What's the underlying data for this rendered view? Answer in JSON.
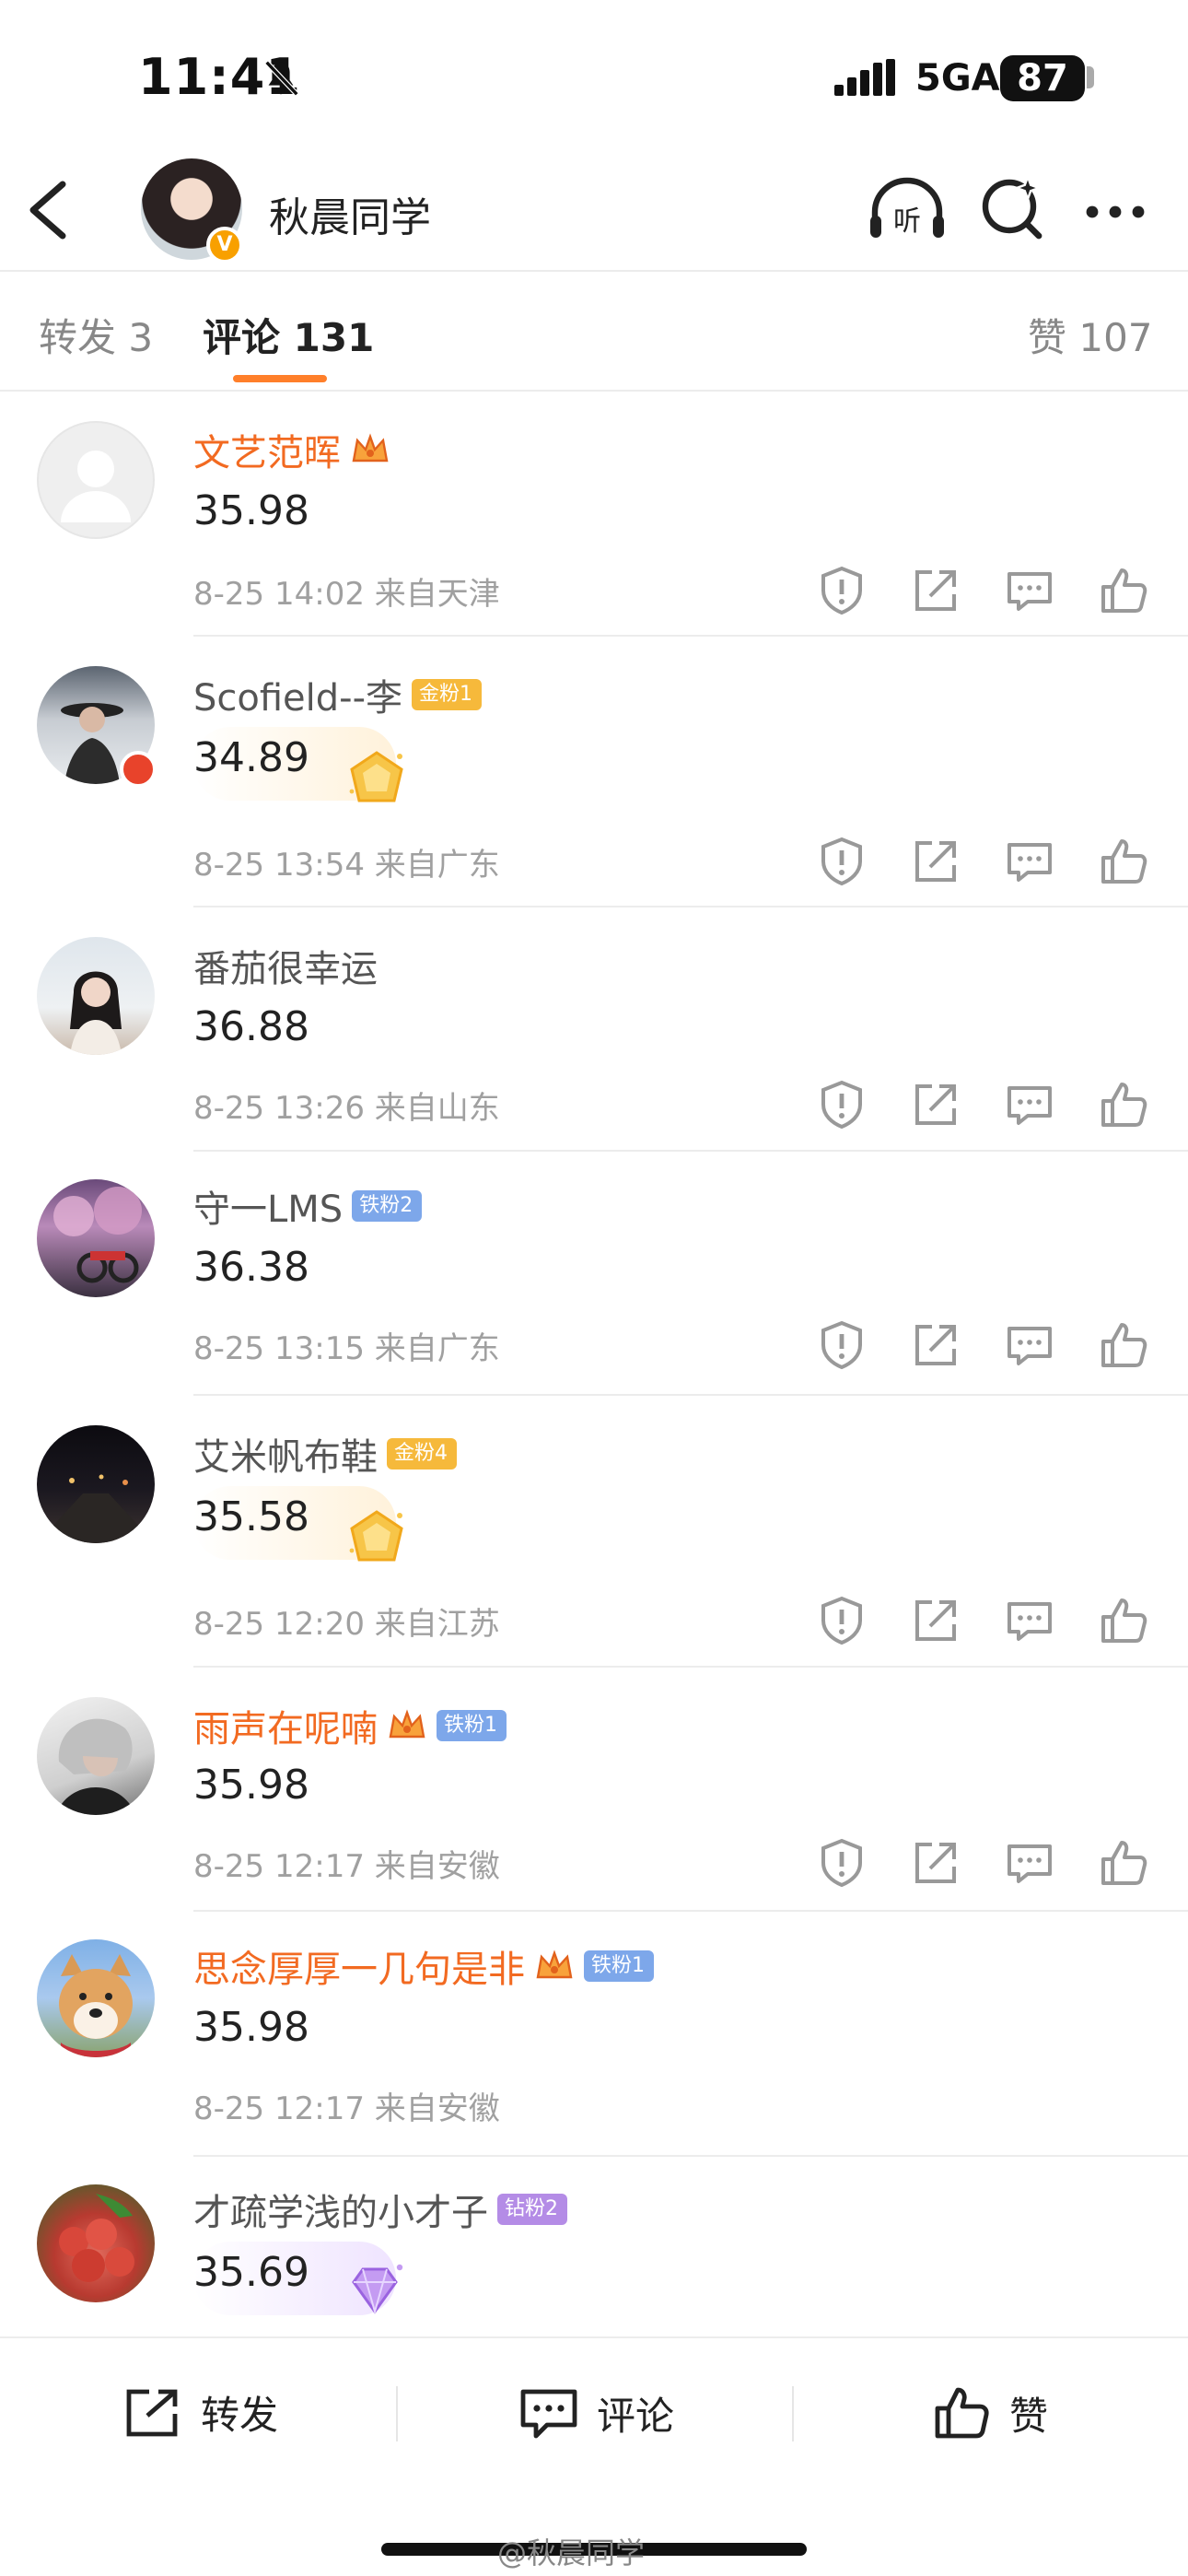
{
  "status": {
    "time": "11:41",
    "network": "5GA",
    "battery": "87"
  },
  "header": {
    "name": "秋晨同学",
    "listen_label": "听"
  },
  "tabs": {
    "repost": "转发 3",
    "comments": "评论 131",
    "likes": "赞 107"
  },
  "comments": [
    {
      "name": "文艺范晖",
      "vip": true,
      "crown": true,
      "badge": null,
      "text": "35.98",
      "meta": "8-25 14:02  来自天津",
      "medal": null
    },
    {
      "name": "Scofield--李",
      "vip": false,
      "crown": false,
      "badge": {
        "label": "金粉1",
        "type": "gold"
      },
      "text": "34.89",
      "meta": "8-25 13:54  来自广东",
      "medal": "gold"
    },
    {
      "name": "番茄很幸运",
      "vip": false,
      "crown": false,
      "badge": null,
      "text": "36.88",
      "meta": "8-25 13:26  来自山东",
      "medal": null
    },
    {
      "name": "守一LMS",
      "vip": false,
      "crown": false,
      "badge": {
        "label": "铁粉2",
        "type": "iron"
      },
      "text": "36.38",
      "meta": "8-25 13:15  来自广东",
      "medal": null
    },
    {
      "name": "艾米帆布鞋",
      "vip": false,
      "crown": false,
      "badge": {
        "label": "金粉4",
        "type": "gold"
      },
      "text": "35.58",
      "meta": "8-25 12:20  来自江苏",
      "medal": "gold"
    },
    {
      "name": "雨声在呢喃",
      "vip": true,
      "crown": true,
      "badge": {
        "label": "铁粉1",
        "type": "iron"
      },
      "text": "35.98",
      "meta": "8-25 12:17  来自安徽",
      "medal": null
    },
    {
      "name": "思念厚厚一几句是非",
      "vip": true,
      "crown": true,
      "badge": {
        "label": "铁粉1",
        "type": "iron"
      },
      "text": "35.98",
      "meta": "8-25 12:17  来自安徽",
      "medal": null
    },
    {
      "name": "才疏学浅的小才子",
      "vip": false,
      "crown": false,
      "badge": {
        "label": "钻粉2",
        "type": "diamond"
      },
      "text": "35.69",
      "meta": "",
      "medal": "diamond"
    }
  ],
  "bottom_bar": {
    "repost": "转发",
    "comment": "评论",
    "like": "赞"
  },
  "watermark": "@秋晨同学",
  "colors": {
    "accent": "#ff7f2a",
    "vip_name": "#f26a21",
    "meta": "#a0a0a0"
  },
  "icons": [
    "back-icon",
    "listen-icon",
    "sparkle-search-icon",
    "more-icon",
    "report-icon",
    "share-icon",
    "comment-icon",
    "like-icon"
  ]
}
